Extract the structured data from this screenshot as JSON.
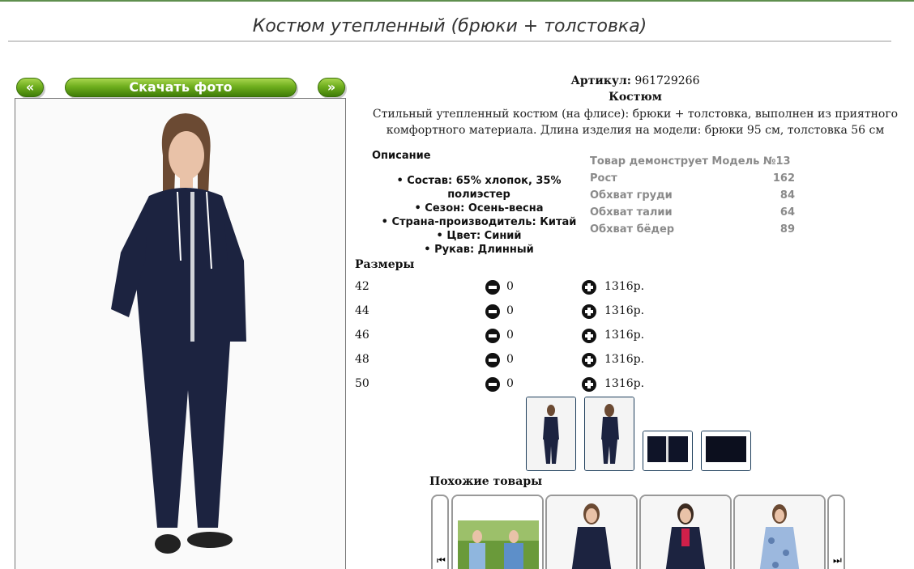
{
  "product": {
    "title": "Костюм утепленный (брюки + толстовка)",
    "article_label": "Артикул:",
    "article_value": "961729266",
    "type": "Костюм",
    "description": "Стильный утепленный костюм (на флисе): брюки + толстовка, выполнен из приятного комфортного материала. Длина изделия на модели: брюки 95 см, толстовка 56 см"
  },
  "gallery": {
    "prev_label": "«",
    "download_label": "Скачать фото",
    "next_label": "»"
  },
  "details": {
    "title": "Описание",
    "items": [
      "Состав: 65% хлопок, 35% полиэстер",
      "Сезон: Осень-весна",
      "Страна-производитель: Китай",
      "Цвет: Синий",
      "Рукав: Длинный"
    ]
  },
  "model": {
    "title": "Товар демонструет Модель №13",
    "rows": [
      {
        "label": "Рост",
        "value": "162"
      },
      {
        "label": "Обхват груди",
        "value": "84"
      },
      {
        "label": "Обхват талии",
        "value": "64"
      },
      {
        "label": "Обхват бёдер",
        "value": "89"
      }
    ]
  },
  "sizes": {
    "title": "Размеры",
    "rows": [
      {
        "size": "42",
        "qty": "0",
        "price": "1316р."
      },
      {
        "size": "44",
        "qty": "0",
        "price": "1316р."
      },
      {
        "size": "46",
        "qty": "0",
        "price": "1316р."
      },
      {
        "size": "48",
        "qty": "0",
        "price": "1316р."
      },
      {
        "size": "50",
        "qty": "0",
        "price": "1316р."
      }
    ]
  },
  "similar": {
    "title": "Похожие товары"
  },
  "icons": {
    "minus": "minus-circle-icon",
    "plus": "plus-circle-icon",
    "prev": "skip-back-icon",
    "next": "skip-forward-icon"
  },
  "colors": {
    "accent_green": "#6fae1e",
    "garment_navy": "#1c2340",
    "thumb_border": "#1f3f5c"
  }
}
